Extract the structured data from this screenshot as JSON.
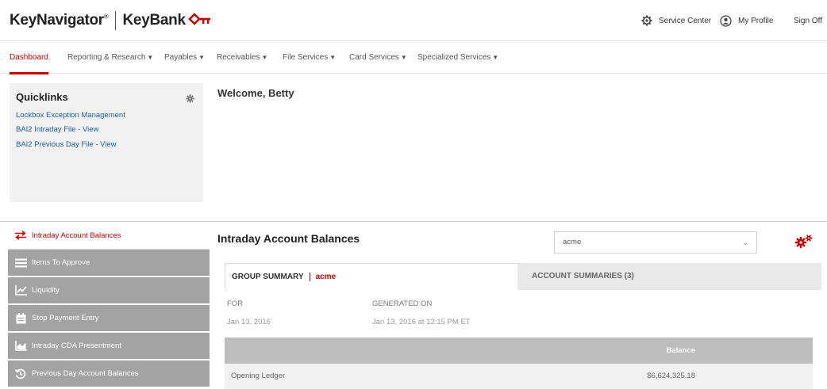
{
  "header": {
    "brand_name": "KeyNavigator",
    "brand_mark": "®",
    "bank_name": "KeyBank",
    "bank_logo_icon": "key-icon",
    "accent": "#cc0000",
    "service_center": "Service Center",
    "service_center_icon": "gear-icon",
    "my_profile": "My Profile",
    "my_profile_icon": "user-circle-icon",
    "sign_off": "Sign Off"
  },
  "nav": {
    "items": [
      {
        "label": "Dashboard",
        "caret": ""
      },
      {
        "label": "Reporting & Research",
        "caret": "▼"
      },
      {
        "label": "Payables",
        "caret": "▼"
      },
      {
        "label": "Receivables",
        "caret": "▼"
      },
      {
        "label": "File Services",
        "caret": "▼"
      },
      {
        "label": "Card Services",
        "caret": "▼"
      },
      {
        "label": "Specialized Services",
        "caret": "▼"
      }
    ],
    "active": "Dashboard"
  },
  "quicklinks": {
    "title": "Quicklinks",
    "links": [
      "Lockbox Exception Management",
      "BAI2 Intraday File - View",
      "BAI2 Previous Day File - View"
    ]
  },
  "welcome": "Welcome, Betty",
  "side_menu": {
    "items": [
      {
        "label": "Intraday Account Balances",
        "icon": "transfer-arrows-icon",
        "active": true
      },
      {
        "label": "Items To Approve",
        "icon": "list-icon",
        "active": false
      },
      {
        "label": "Liquidity",
        "icon": "chart-line-icon",
        "active": false
      },
      {
        "label": "Stop Payment Entry",
        "icon": "calendar-icon",
        "active": false
      },
      {
        "label": "Intraday CDA Presentment",
        "icon": "chart-area-icon",
        "active": false
      },
      {
        "label": "Previous Day Account Balances",
        "icon": "history-icon",
        "active": false
      }
    ]
  },
  "panel": {
    "title": "Intraday Account Balances",
    "select_value": "acme",
    "settings_icon": "gears-icon",
    "tabs": {
      "group_summary": "GROUP SUMMARY",
      "group_name": "acme",
      "account_summaries": "ACCOUNT SUMMARIES (3)"
    },
    "for_label": "FOR",
    "for_value": "Jan 13, 2016",
    "generated_label": "GENERATED ON",
    "generated_value": "Jan 13, 2016 at 12:15 PM ET",
    "table": {
      "columns": [
        "",
        "Balance"
      ],
      "rows": [
        {
          "label": "Opening Ledger",
          "balance": "$6,624,325.18"
        }
      ]
    }
  }
}
